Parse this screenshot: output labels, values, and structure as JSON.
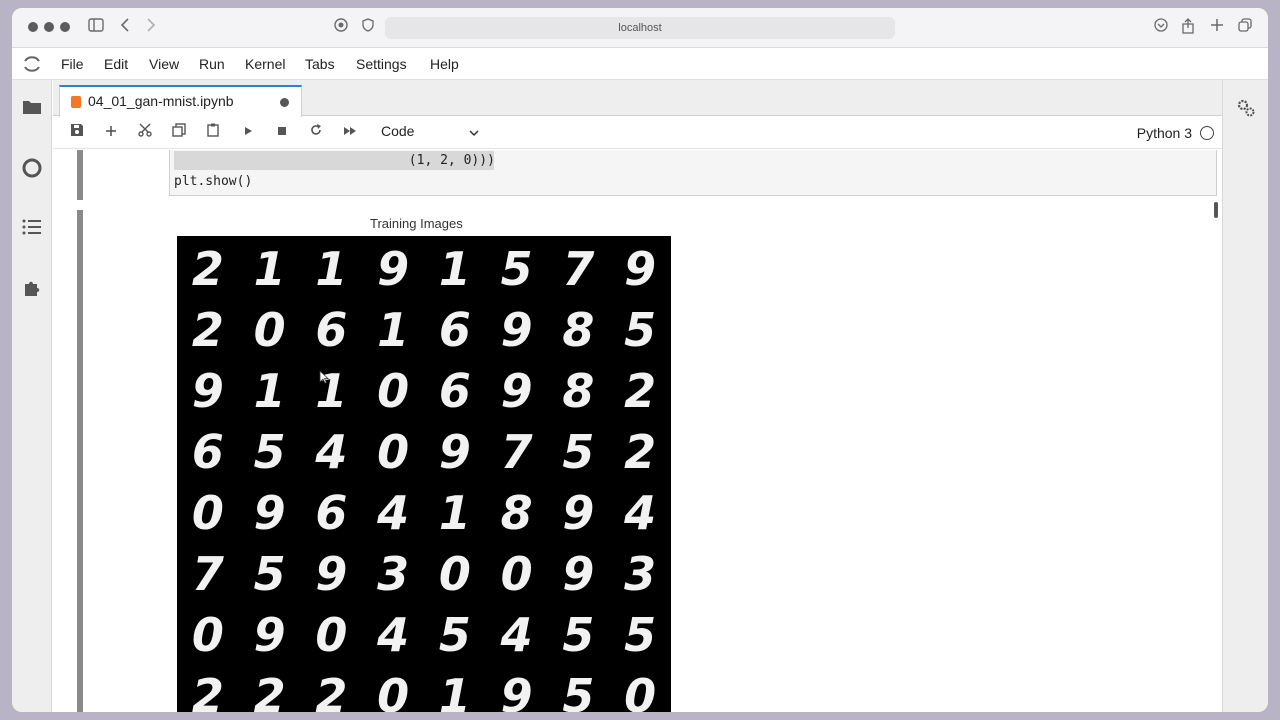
{
  "browser": {
    "url": "localhost"
  },
  "menubar": {
    "items": [
      "File",
      "Edit",
      "View",
      "Run",
      "Kernel",
      "Tabs",
      "Settings",
      "Help"
    ]
  },
  "tab": {
    "label": "04_01_gan-mnist.ipynb"
  },
  "toolbar": {
    "cell_type": "Code",
    "kernel": "Python 3"
  },
  "code": {
    "line1": "                              (1, 2, 0)))",
    "line2": "plt.show()"
  },
  "figure": {
    "title": "Training Images",
    "rows": [
      [
        "2",
        "1",
        "1",
        "9",
        "1",
        "5",
        "7",
        "9"
      ],
      [
        "2",
        "0",
        "6",
        "1",
        "6",
        "9",
        "8",
        "5"
      ],
      [
        "9",
        "1",
        "1",
        "0",
        "6",
        "9",
        "8",
        "2"
      ],
      [
        "6",
        "5",
        "4",
        "0",
        "9",
        "7",
        "5",
        "2"
      ],
      [
        "0",
        "9",
        "6",
        "4",
        "1",
        "8",
        "9",
        "4"
      ],
      [
        "7",
        "5",
        "9",
        "3",
        "0",
        "0",
        "9",
        "3"
      ],
      [
        "0",
        "9",
        "0",
        "4",
        "5",
        "4",
        "5",
        "5"
      ],
      [
        "2",
        "2",
        "2",
        "0",
        "1",
        "9",
        "5",
        "0"
      ]
    ]
  },
  "colors": {
    "accent": "#2d7fd8",
    "notebook_icon": "#f37726",
    "background": "#b9b3c6"
  },
  "icons": {
    "sidebar": [
      "folder-icon",
      "running-icon",
      "table-of-contents-icon",
      "extension-icon"
    ],
    "right_sidebar": [
      "property-inspector-icon"
    ]
  }
}
